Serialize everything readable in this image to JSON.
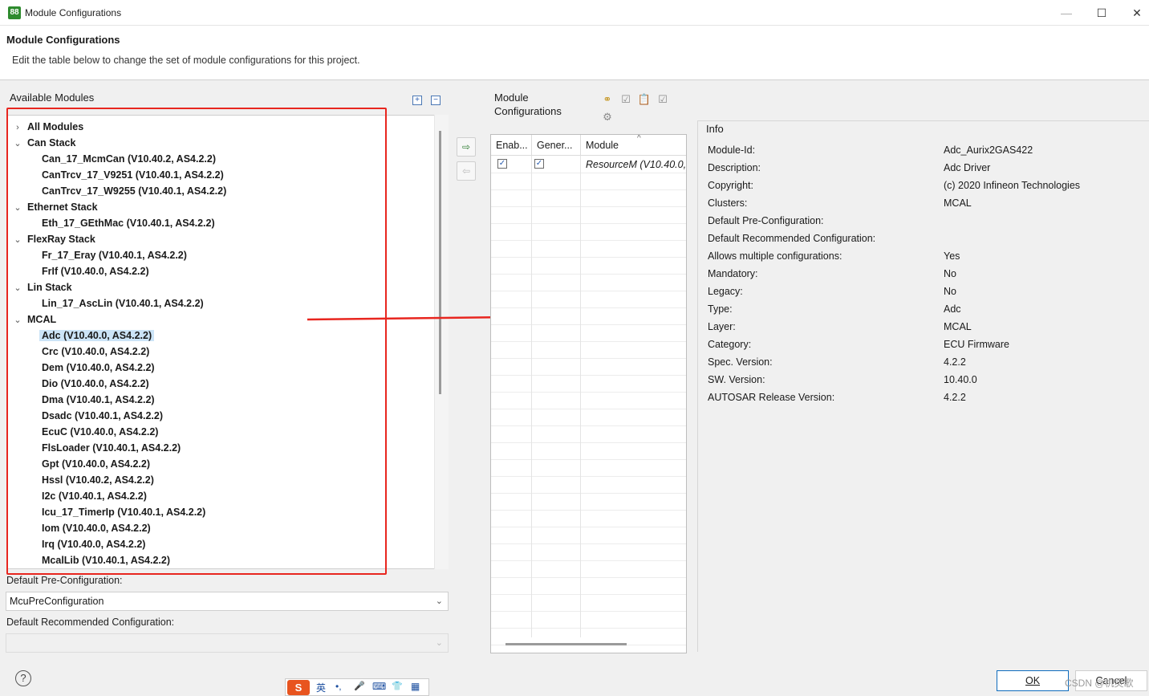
{
  "window": {
    "title": "Module Configurations",
    "icon": "app-icon",
    "minimize": "—",
    "maximize": "☐",
    "close": "✕"
  },
  "header": {
    "title": "Module Configurations",
    "description": "Edit the table below to change the set of module configurations for this project."
  },
  "left": {
    "available_label": "Available Modules",
    "expand_icon": "+",
    "collapse_icon": "−",
    "tree": [
      {
        "label": "All Modules",
        "level": 0,
        "twisty": "›"
      },
      {
        "label": "Can Stack",
        "level": 0,
        "twisty": "⌄"
      },
      {
        "label": "Can_17_McmCan (V10.40.2, AS4.2.2)",
        "level": 1
      },
      {
        "label": "CanTrcv_17_V9251 (V10.40.1, AS4.2.2)",
        "level": 1
      },
      {
        "label": "CanTrcv_17_W9255 (V10.40.1, AS4.2.2)",
        "level": 1
      },
      {
        "label": "Ethernet Stack",
        "level": 0,
        "twisty": "⌄"
      },
      {
        "label": "Eth_17_GEthMac (V10.40.1, AS4.2.2)",
        "level": 1
      },
      {
        "label": "FlexRay Stack",
        "level": 0,
        "twisty": "⌄"
      },
      {
        "label": "Fr_17_Eray (V10.40.1, AS4.2.2)",
        "level": 1
      },
      {
        "label": "FrIf (V10.40.0, AS4.2.2)",
        "level": 1
      },
      {
        "label": "Lin Stack",
        "level": 0,
        "twisty": "⌄"
      },
      {
        "label": "Lin_17_AscLin (V10.40.1, AS4.2.2)",
        "level": 1
      },
      {
        "label": "MCAL",
        "level": 0,
        "twisty": "⌄"
      },
      {
        "label": "Adc (V10.40.0, AS4.2.2)",
        "level": 1,
        "selected": true
      },
      {
        "label": "Crc (V10.40.0, AS4.2.2)",
        "level": 1
      },
      {
        "label": "Dem (V10.40.0, AS4.2.2)",
        "level": 1
      },
      {
        "label": "Dio (V10.40.0, AS4.2.2)",
        "level": 1
      },
      {
        "label": "Dma (V10.40.1, AS4.2.2)",
        "level": 1
      },
      {
        "label": "Dsadc (V10.40.1, AS4.2.2)",
        "level": 1
      },
      {
        "label": "EcuC (V10.40.0, AS4.2.2)",
        "level": 1
      },
      {
        "label": "FlsLoader (V10.40.1, AS4.2.2)",
        "level": 1
      },
      {
        "label": "Gpt (V10.40.0, AS4.2.2)",
        "level": 1
      },
      {
        "label": "Hssl (V10.40.2, AS4.2.2)",
        "level": 1
      },
      {
        "label": "I2c (V10.40.1, AS4.2.2)",
        "level": 1
      },
      {
        "label": "Icu_17_TimerIp (V10.40.1, AS4.2.2)",
        "level": 1
      },
      {
        "label": "Iom (V10.40.0, AS4.2.2)",
        "level": 1
      },
      {
        "label": "Irq (V10.40.0, AS4.2.2)",
        "level": 1
      },
      {
        "label": "McalLib (V10.40.1, AS4.2.2)",
        "level": 1
      }
    ],
    "default_pre_label": "Default Pre-Configuration:",
    "default_pre_value": "McuPreConfiguration",
    "default_rec_label": "Default Recommended Configuration:",
    "default_rec_value": ""
  },
  "middle": {
    "add_icon": "add-module-icon",
    "remove_icon": "remove-module-icon"
  },
  "module_configs": {
    "label_line1": "Module",
    "label_line2": "Configurations",
    "columns": [
      "Enab...",
      "Gener...",
      "Module"
    ],
    "rows": [
      {
        "enabled": true,
        "generate": true,
        "module": "ResourceM (V10.40.0,"
      }
    ],
    "check_glyph": "✓"
  },
  "info": {
    "title": "Info",
    "fields": [
      {
        "key": "Module-Id:",
        "value": "Adc_Aurix2GAS422"
      },
      {
        "key": "Description:",
        "value": "Adc Driver"
      },
      {
        "key": "Copyright:",
        "value": "(c) 2020 Infineon Technologies"
      },
      {
        "key": "Clusters:",
        "value": "MCAL"
      },
      {
        "key": "Default Pre-Configuration:",
        "value": ""
      },
      {
        "key": "Default Recommended Configuration:",
        "value": ""
      },
      {
        "key": "Allows multiple configurations:",
        "value": "Yes"
      },
      {
        "key": "Mandatory:",
        "value": "No"
      },
      {
        "key": "Legacy:",
        "value": "No"
      },
      {
        "key": "Type:",
        "value": "Adc"
      },
      {
        "key": "Layer:",
        "value": "MCAL"
      },
      {
        "key": "Category:",
        "value": "ECU Firmware"
      },
      {
        "key": "Spec. Version:",
        "value": "4.2.2"
      },
      {
        "key": "SW. Version:",
        "value": "10.40.0"
      },
      {
        "key": "AUTOSAR Release Version:",
        "value": "4.2.2"
      }
    ]
  },
  "footer": {
    "help": "?",
    "ok": "OK",
    "cancel": "Cancel",
    "watermark": "CSDN @机灵歌"
  },
  "ime": {
    "items": [
      "S",
      "英",
      "•,",
      "🎤",
      "⌨",
      "👕",
      "▦"
    ]
  },
  "colors": {
    "annotation": "#e8261f",
    "selection": "#cce4f7",
    "accent": "#0f6cbd"
  }
}
